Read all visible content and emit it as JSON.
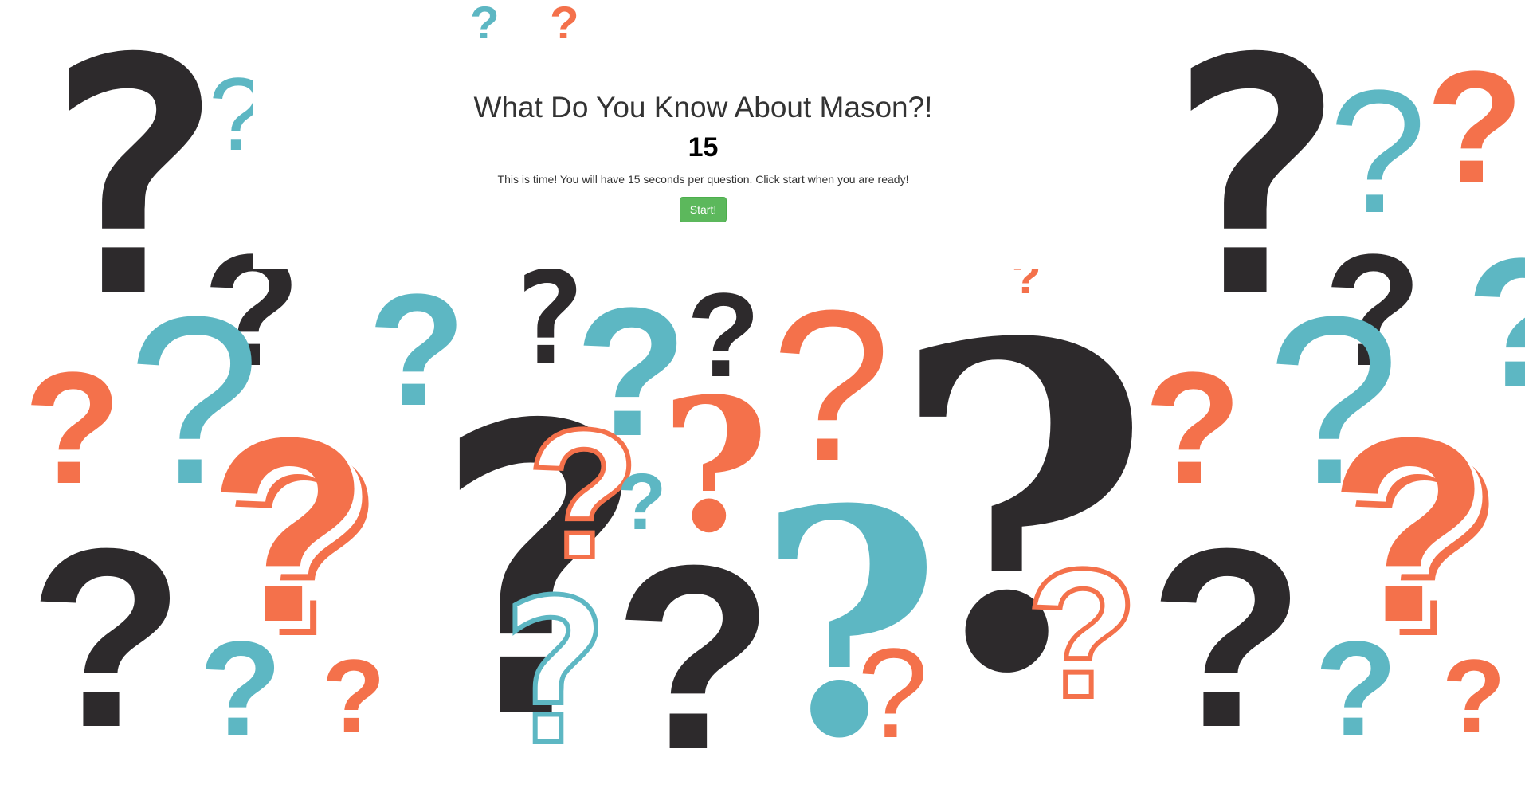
{
  "quiz": {
    "title": "What Do You Know About Mason?!",
    "timer": "15",
    "instructions": "This is time! You will have 15 seconds per question. Click start when you are ready!",
    "start_label": "Start!"
  },
  "background": {
    "glyph": "?",
    "colors": {
      "dark": "#2d2a2c",
      "orange": "#f4714b",
      "teal": "#5db7c3"
    }
  },
  "colors": {
    "start_button": "#5cb85c",
    "panel": "#ffffff"
  }
}
